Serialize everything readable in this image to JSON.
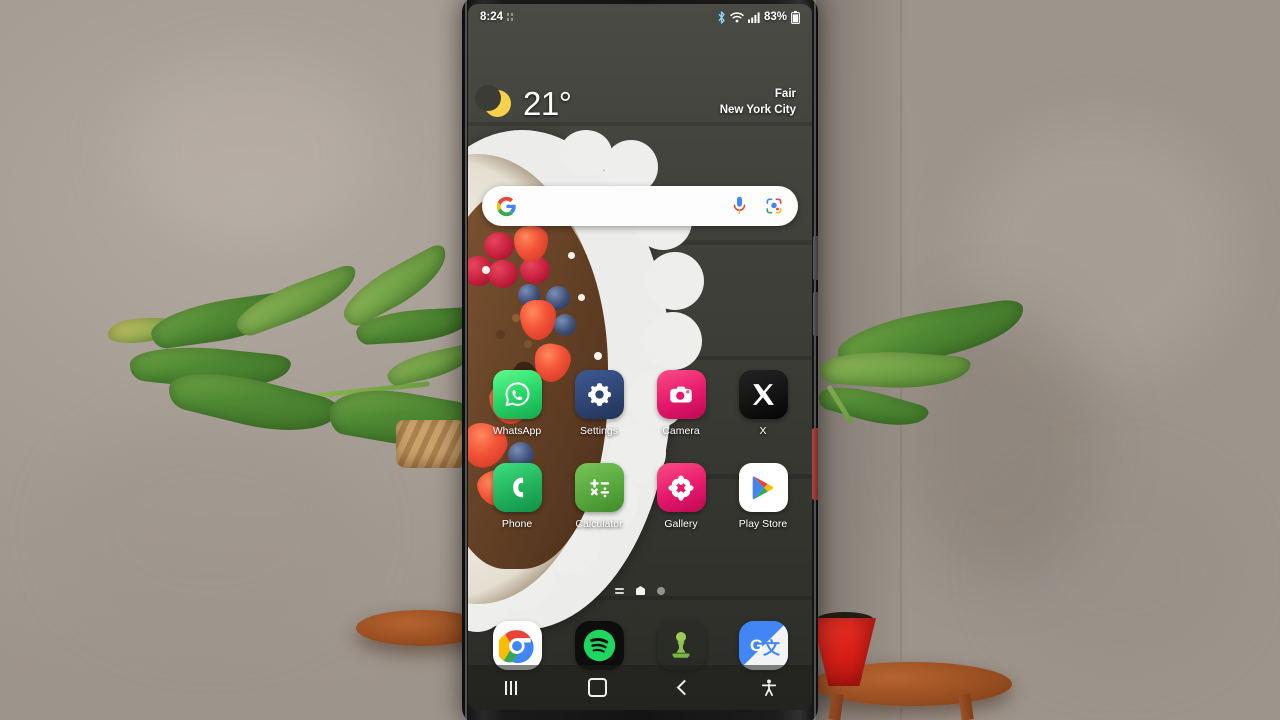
{
  "device": {
    "name": "samsung-galaxy-phone",
    "screen_label": "Android home screen"
  },
  "status_bar": {
    "time": "8:24",
    "battery_percent": "83%",
    "icons": [
      "dnd-icon",
      "bluetooth-icon",
      "wifi-icon",
      "signal-icon",
      "battery-icon"
    ]
  },
  "weather_widget": {
    "icon": "crescent-moon-icon",
    "temperature": "21°",
    "condition": "Fair",
    "location": "New York City"
  },
  "search_bar": {
    "placeholder": "",
    "value": "",
    "google_icon": "google-g-icon",
    "mic_icon": "microphone-icon",
    "lens_icon": "google-lens-icon"
  },
  "app_grid": {
    "rows": [
      [
        {
          "label": "WhatsApp",
          "icon": "whatsapp-icon",
          "color": "#25D366"
        },
        {
          "label": "Settings",
          "icon": "settings-gear-icon",
          "color": "#2E4372"
        },
        {
          "label": "Camera",
          "icon": "camera-icon",
          "color": "#E6186B"
        },
        {
          "label": "X",
          "icon": "x-twitter-icon",
          "color": "#141414"
        }
      ],
      [
        {
          "label": "Phone",
          "icon": "phone-handset-icon",
          "color": "#21B25B"
        },
        {
          "label": "Calculator",
          "icon": "calculator-icon",
          "color": "#57A93D"
        },
        {
          "label": "Gallery",
          "icon": "gallery-flower-icon",
          "color": "#E6186B"
        },
        {
          "label": "Play Store",
          "icon": "play-store-icon",
          "color": "#FFFFFF"
        }
      ]
    ]
  },
  "page_indicator": {
    "items": [
      "widgets-page-icon",
      "home-page-icon",
      "page-dot"
    ],
    "active_index": 1
  },
  "dock": {
    "items": [
      {
        "label": "Chrome",
        "icon": "chrome-icon",
        "color": "#FFFFFF"
      },
      {
        "label": "Spotify",
        "icon": "spotify-icon",
        "color": "#111111"
      },
      {
        "label": "Chess",
        "icon": "chess-pawn-icon",
        "color": "#8CC152"
      },
      {
        "label": "Google Translate",
        "icon": "google-translate-icon",
        "color": "#4285F4"
      }
    ]
  },
  "nav_bar": {
    "buttons": [
      {
        "name": "recents-button",
        "icon": "recents-icon"
      },
      {
        "name": "home-button",
        "icon": "home-square-icon"
      },
      {
        "name": "back-button",
        "icon": "back-chevron-icon"
      },
      {
        "name": "accessibility-button",
        "icon": "accessibility-icon"
      }
    ]
  },
  "hardware": {
    "volume_up": "volume-up-button",
    "volume_down": "volume-down-button",
    "power": "power-button"
  },
  "background_scene": {
    "wall_color": "#a9a097",
    "plant_left": "potted-plant-left",
    "plant_right": "potted-plant-red-pot",
    "table": "wooden-side-table"
  }
}
